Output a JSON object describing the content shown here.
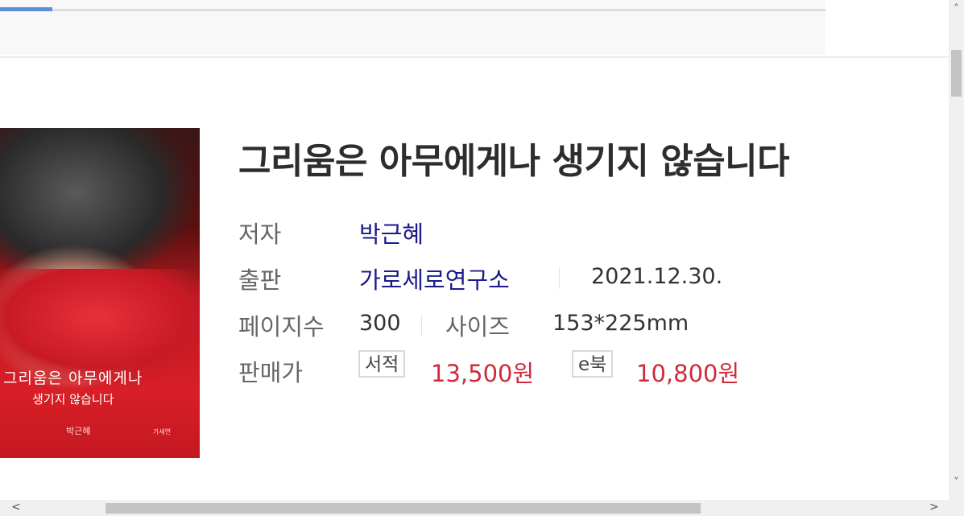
{
  "book": {
    "title": "그리움은 아무에게나 생기지 않습니다",
    "labels": {
      "author": "저자",
      "publisher": "출판",
      "pages": "페이지수",
      "size": "사이즈",
      "price": "판매가"
    },
    "author": "박근혜",
    "publisher": "가로세로연구소",
    "date": "2021.12.30.",
    "pages": "300",
    "size": "153*225mm",
    "prices": {
      "print_tag": "서적",
      "print_price": "13,500원",
      "ebook_tag": "e북",
      "ebook_price": "10,800원"
    }
  },
  "cover": {
    "title_line1": "그리움은 아무에게나",
    "title_line2": "생기지 않습니다",
    "author": "박근혜",
    "publisher_mark": "가세연"
  },
  "scrollbars": {
    "up": "˄",
    "down": "˅",
    "left": "<",
    "right": ">"
  },
  "colors": {
    "link": "#1b1b8a",
    "price": "#d12a3a",
    "accent": "#5a8fd6"
  }
}
